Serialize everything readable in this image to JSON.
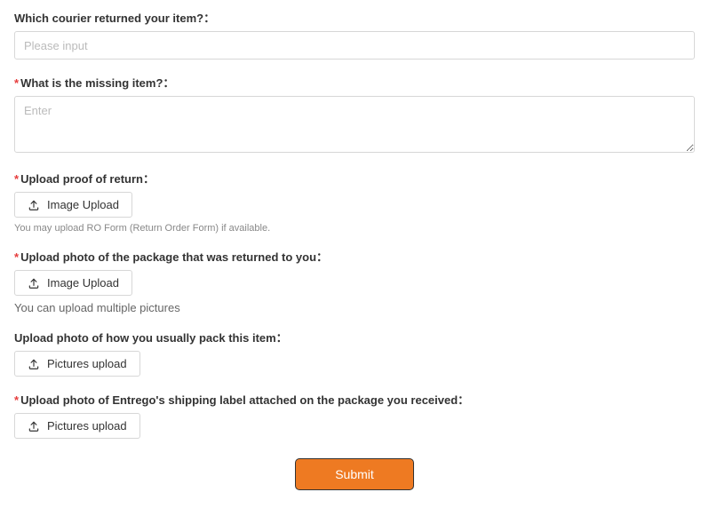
{
  "fields": {
    "courier": {
      "label": "Which courier returned your item?：",
      "placeholder": "Please input",
      "required": false
    },
    "missing": {
      "label": "What is the missing item?：",
      "placeholder": "Enter",
      "required": true
    },
    "proof": {
      "label": "Upload proof of return：",
      "button": "Image Upload",
      "help": "You may upload RO Form (Return Order Form) if available.",
      "required": true
    },
    "package_photo": {
      "label": "Upload photo of the package that was returned to you：",
      "button": "Image Upload",
      "help": "You can upload multiple pictures",
      "required": true
    },
    "pack_photo": {
      "label": "Upload photo of how you usually pack this item：",
      "button": "Pictures upload",
      "required": false
    },
    "label_photo": {
      "label": "Upload photo of Entrego's shipping label attached on the package you received：",
      "button": "Pictures upload",
      "required": true
    }
  },
  "submit_label": "Submit",
  "required_marker": "*"
}
